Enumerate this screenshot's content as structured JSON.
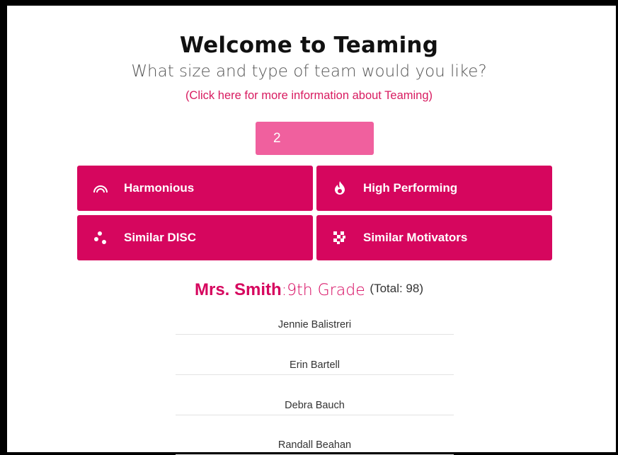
{
  "header": {
    "title": "Welcome to Teaming",
    "subtitle": "What size and type of team would you like?",
    "info_link": "(Click here for more information about Teaming)"
  },
  "team_size": {
    "value": "2"
  },
  "team_types": [
    {
      "label": "Harmonious",
      "icon": "rainbow-icon"
    },
    {
      "label": "High Performing",
      "icon": "flame-icon"
    },
    {
      "label": "Similar DISC",
      "icon": "dots-icon"
    },
    {
      "label": "Similar Motivators",
      "icon": "checker-icon"
    }
  ],
  "class": {
    "teacher": "Mrs. Smith",
    "grade": ":9th Grade",
    "total": "(Total: 98)"
  },
  "students": [
    "Jennie Balistreri",
    "Erin Bartell",
    "Debra Bauch",
    "Randall Beahan"
  ],
  "colors": {
    "accent": "#d6065e",
    "input_bg": "#f0609e",
    "link": "#d81b60"
  }
}
